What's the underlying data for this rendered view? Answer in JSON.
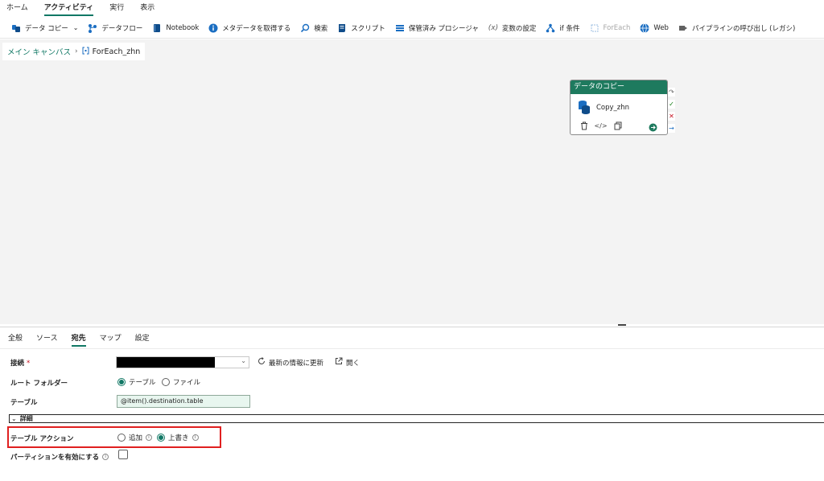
{
  "top_tabs": [
    {
      "label": "ホーム",
      "active": false
    },
    {
      "label": "アクティビティ",
      "active": true
    },
    {
      "label": "実行",
      "active": false
    },
    {
      "label": "表示",
      "active": false
    }
  ],
  "toolbar": {
    "copy_data": "データ コピー",
    "dataflow": "データフロー",
    "notebook": "Notebook",
    "get_metadata": "メタデータを取得する",
    "lookup": "検索",
    "script": "スクリプト",
    "stored_procedure": "保管済み プロシージャ",
    "set_variable": "変数の設定",
    "if_condition": "if 条件",
    "foreach": "ForEach",
    "web": "Web",
    "invoke_pipeline": "パイプラインの呼び出し (レガシ)"
  },
  "breadcrumb": {
    "root": "メイン キャンバス",
    "current": "ForEach_zhn"
  },
  "activity": {
    "header": "データのコピー",
    "name": "Copy_zhn"
  },
  "panel": {
    "tabs": [
      {
        "label": "全般",
        "active": false
      },
      {
        "label": "ソース",
        "active": false
      },
      {
        "label": "宛先",
        "active": true
      },
      {
        "label": "マップ",
        "active": false
      },
      {
        "label": "設定",
        "active": false
      }
    ],
    "connection_label": "接続",
    "required_mark": "*",
    "refresh_label": "最新の情報に更新",
    "open_label": "開く",
    "root_folder_label": "ルート フォルダー",
    "root_folder_options": [
      "テーブル",
      "ファイル"
    ],
    "root_folder_selected": "テーブル",
    "table_label": "テーブル",
    "table_value": "@item().destination.table",
    "details_label": "詳細",
    "table_action_label": "テーブル アクション",
    "table_action_options": [
      "追加",
      "上書き"
    ],
    "table_action_selected": "上書き",
    "partition_label": "パーティションを有効にする",
    "partition_enabled": false
  },
  "colors": {
    "accent": "#117865",
    "activity_header": "#1e7a5e",
    "highlight": "#e02020",
    "canvas_bg": "#f3f3f3"
  }
}
